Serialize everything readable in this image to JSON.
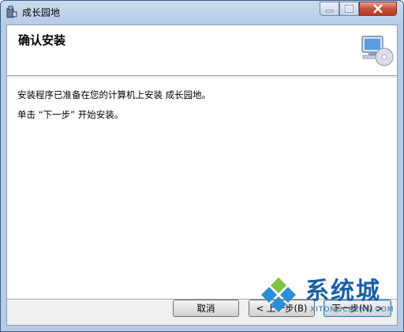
{
  "window": {
    "title": "成长园地"
  },
  "banner": {
    "title": "确认安装",
    "icon": "computer-cd-icon"
  },
  "content": {
    "line1": "安装程序已准备在您的计算机上安装 成长园地。",
    "line2": "单击 “下一步” 开始安装。"
  },
  "buttons": {
    "cancel": "取消",
    "back": "< 上一步(B)",
    "next": "下一步(N) >"
  },
  "watermark": {
    "text": "系统城",
    "sub": "XITONGCHENG.COM"
  },
  "colors": {
    "titlebar": "#b9cfe8",
    "close": "#c7503c",
    "accent": "#1a5fa6"
  }
}
